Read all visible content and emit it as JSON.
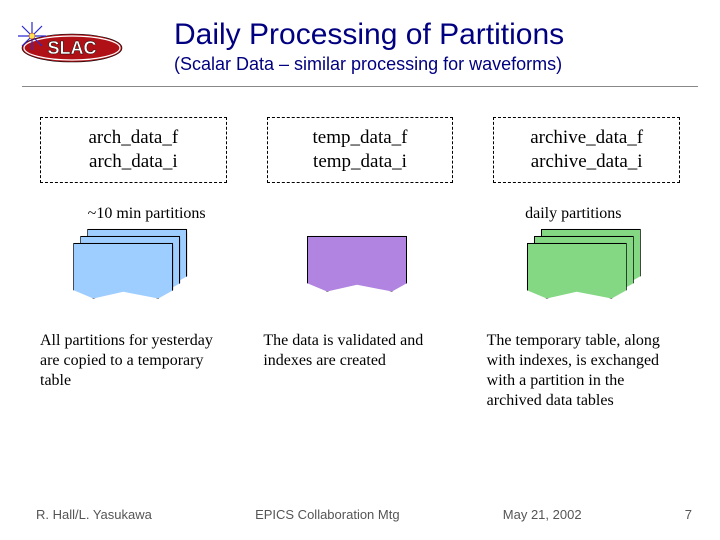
{
  "title": "Daily Processing of Partitions",
  "subtitle": "(Scalar Data – similar processing for waveforms)",
  "boxes": {
    "a": {
      "l1": "arch_data_f",
      "l2": "arch_data_i"
    },
    "b": {
      "l1": "temp_data_f",
      "l2": "temp_data_i"
    },
    "c": {
      "l1": "archive_data_f",
      "l2": "archive_data_i"
    }
  },
  "labels": {
    "left": "~10 min partitions",
    "right": "daily partitions"
  },
  "desc": {
    "a": "All partitions for yesterday are copied to a temporary table",
    "b": "The data is validated and indexes are created",
    "c": "The temporary table, along with indexes, is exchanged with a partition in the archived data tables"
  },
  "footer": {
    "left": "R. Hall/L. Yasukawa",
    "center": "EPICS Collaboration Mtg",
    "right": "May 21, 2002",
    "page": "7"
  }
}
